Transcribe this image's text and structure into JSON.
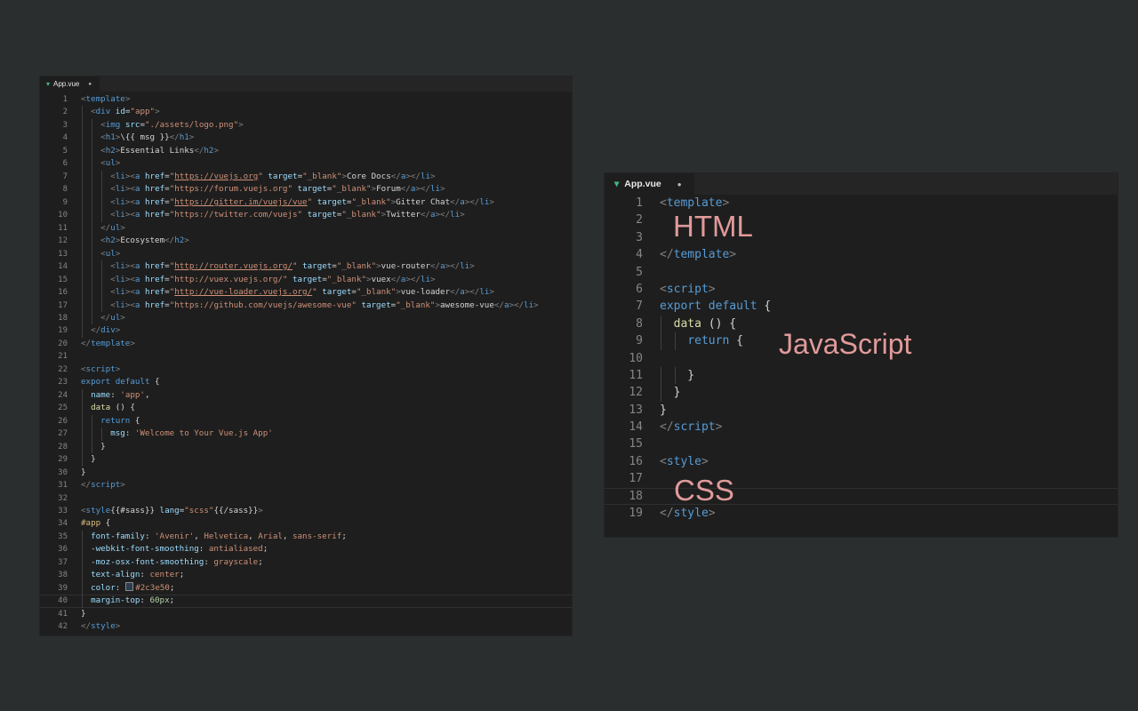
{
  "left_editor": {
    "tab": {
      "icon": "vue-file-icon",
      "filename": "App.vue",
      "modified_indicator": "●"
    },
    "lines": [
      [
        [
          "p",
          "<"
        ],
        [
          "t",
          "template"
        ],
        [
          "p",
          ">"
        ]
      ],
      [
        [
          "w",
          "  "
        ],
        [
          "p",
          "<"
        ],
        [
          "t",
          "div"
        ],
        [
          "w",
          " "
        ],
        [
          "a",
          "id"
        ],
        [
          "w",
          "="
        ],
        [
          "s",
          "\"app\""
        ],
        [
          "p",
          ">"
        ]
      ],
      [
        [
          "w",
          "    "
        ],
        [
          "p",
          "<"
        ],
        [
          "t",
          "img"
        ],
        [
          "w",
          " "
        ],
        [
          "a",
          "src"
        ],
        [
          "w",
          "="
        ],
        [
          "s",
          "\"./assets/logo.png\""
        ],
        [
          "p",
          ">"
        ]
      ],
      [
        [
          "w",
          "    "
        ],
        [
          "p",
          "<"
        ],
        [
          "t",
          "h1"
        ],
        [
          "p",
          ">"
        ],
        [
          "w",
          "\\{{ msg }}"
        ],
        [
          "p",
          "</"
        ],
        [
          "t",
          "h1"
        ],
        [
          "p",
          ">"
        ]
      ],
      [
        [
          "w",
          "    "
        ],
        [
          "p",
          "<"
        ],
        [
          "t",
          "h2"
        ],
        [
          "p",
          ">"
        ],
        [
          "w",
          "Essential Links"
        ],
        [
          "p",
          "</"
        ],
        [
          "t",
          "h2"
        ],
        [
          "p",
          ">"
        ]
      ],
      [
        [
          "w",
          "    "
        ],
        [
          "p",
          "<"
        ],
        [
          "t",
          "ul"
        ],
        [
          "p",
          ">"
        ]
      ],
      [
        [
          "w",
          "      "
        ],
        [
          "p",
          "<"
        ],
        [
          "t",
          "li"
        ],
        [
          "p",
          "><"
        ],
        [
          "t",
          "a"
        ],
        [
          "w",
          " "
        ],
        [
          "a",
          "href"
        ],
        [
          "w",
          "="
        ],
        [
          "s",
          "\""
        ],
        [
          "u",
          "https://vuejs.org"
        ],
        [
          "s",
          "\""
        ],
        [
          "w",
          " "
        ],
        [
          "a",
          "target"
        ],
        [
          "w",
          "="
        ],
        [
          "s",
          "\"_blank\""
        ],
        [
          "p",
          ">"
        ],
        [
          "w",
          "Core Docs"
        ],
        [
          "p",
          "</"
        ],
        [
          "t",
          "a"
        ],
        [
          "p",
          "></"
        ],
        [
          "t",
          "li"
        ],
        [
          "p",
          ">"
        ]
      ],
      [
        [
          "w",
          "      "
        ],
        [
          "p",
          "<"
        ],
        [
          "t",
          "li"
        ],
        [
          "p",
          "><"
        ],
        [
          "t",
          "a"
        ],
        [
          "w",
          " "
        ],
        [
          "a",
          "href"
        ],
        [
          "w",
          "="
        ],
        [
          "s",
          "\"https://forum.vuejs.org\""
        ],
        [
          "w",
          " "
        ],
        [
          "a",
          "target"
        ],
        [
          "w",
          "="
        ],
        [
          "s",
          "\"_blank\""
        ],
        [
          "p",
          ">"
        ],
        [
          "w",
          "Forum"
        ],
        [
          "p",
          "</"
        ],
        [
          "t",
          "a"
        ],
        [
          "p",
          "></"
        ],
        [
          "t",
          "li"
        ],
        [
          "p",
          ">"
        ]
      ],
      [
        [
          "w",
          "      "
        ],
        [
          "p",
          "<"
        ],
        [
          "t",
          "li"
        ],
        [
          "p",
          "><"
        ],
        [
          "t",
          "a"
        ],
        [
          "w",
          " "
        ],
        [
          "a",
          "href"
        ],
        [
          "w",
          "="
        ],
        [
          "s",
          "\""
        ],
        [
          "u",
          "https://gitter.im/vuejs/vue"
        ],
        [
          "s",
          "\""
        ],
        [
          "w",
          " "
        ],
        [
          "a",
          "target"
        ],
        [
          "w",
          "="
        ],
        [
          "s",
          "\"_blank\""
        ],
        [
          "p",
          ">"
        ],
        [
          "w",
          "Gitter Chat"
        ],
        [
          "p",
          "</"
        ],
        [
          "t",
          "a"
        ],
        [
          "p",
          "></"
        ],
        [
          "t",
          "li"
        ],
        [
          "p",
          ">"
        ]
      ],
      [
        [
          "w",
          "      "
        ],
        [
          "p",
          "<"
        ],
        [
          "t",
          "li"
        ],
        [
          "p",
          "><"
        ],
        [
          "t",
          "a"
        ],
        [
          "w",
          " "
        ],
        [
          "a",
          "href"
        ],
        [
          "w",
          "="
        ],
        [
          "s",
          "\"https://twitter.com/vuejs\""
        ],
        [
          "w",
          " "
        ],
        [
          "a",
          "target"
        ],
        [
          "w",
          "="
        ],
        [
          "s",
          "\"_blank\""
        ],
        [
          "p",
          ">"
        ],
        [
          "w",
          "Twitter"
        ],
        [
          "p",
          "</"
        ],
        [
          "t",
          "a"
        ],
        [
          "p",
          "></"
        ],
        [
          "t",
          "li"
        ],
        [
          "p",
          ">"
        ]
      ],
      [
        [
          "w",
          "    "
        ],
        [
          "p",
          "</"
        ],
        [
          "t",
          "ul"
        ],
        [
          "p",
          ">"
        ]
      ],
      [
        [
          "w",
          "    "
        ],
        [
          "p",
          "<"
        ],
        [
          "t",
          "h2"
        ],
        [
          "p",
          ">"
        ],
        [
          "w",
          "Ecosystem"
        ],
        [
          "p",
          "</"
        ],
        [
          "t",
          "h2"
        ],
        [
          "p",
          ">"
        ]
      ],
      [
        [
          "w",
          "    "
        ],
        [
          "p",
          "<"
        ],
        [
          "t",
          "ul"
        ],
        [
          "p",
          ">"
        ]
      ],
      [
        [
          "w",
          "      "
        ],
        [
          "p",
          "<"
        ],
        [
          "t",
          "li"
        ],
        [
          "p",
          "><"
        ],
        [
          "t",
          "a"
        ],
        [
          "w",
          " "
        ],
        [
          "a",
          "href"
        ],
        [
          "w",
          "="
        ],
        [
          "s",
          "\""
        ],
        [
          "u",
          "http://router.vuejs.org/"
        ],
        [
          "s",
          "\""
        ],
        [
          "w",
          " "
        ],
        [
          "a",
          "target"
        ],
        [
          "w",
          "="
        ],
        [
          "s",
          "\"_blank\""
        ],
        [
          "p",
          ">"
        ],
        [
          "w",
          "vue-router"
        ],
        [
          "p",
          "</"
        ],
        [
          "t",
          "a"
        ],
        [
          "p",
          "></"
        ],
        [
          "t",
          "li"
        ],
        [
          "p",
          ">"
        ]
      ],
      [
        [
          "w",
          "      "
        ],
        [
          "p",
          "<"
        ],
        [
          "t",
          "li"
        ],
        [
          "p",
          "><"
        ],
        [
          "t",
          "a"
        ],
        [
          "w",
          " "
        ],
        [
          "a",
          "href"
        ],
        [
          "w",
          "="
        ],
        [
          "s",
          "\"http://vuex.vuejs.org/\""
        ],
        [
          "w",
          " "
        ],
        [
          "a",
          "target"
        ],
        [
          "w",
          "="
        ],
        [
          "s",
          "\"_blank\""
        ],
        [
          "p",
          ">"
        ],
        [
          "w",
          "vuex"
        ],
        [
          "p",
          "</"
        ],
        [
          "t",
          "a"
        ],
        [
          "p",
          "></"
        ],
        [
          "t",
          "li"
        ],
        [
          "p",
          ">"
        ]
      ],
      [
        [
          "w",
          "      "
        ],
        [
          "p",
          "<"
        ],
        [
          "t",
          "li"
        ],
        [
          "p",
          "><"
        ],
        [
          "t",
          "a"
        ],
        [
          "w",
          " "
        ],
        [
          "a",
          "href"
        ],
        [
          "w",
          "="
        ],
        [
          "s",
          "\""
        ],
        [
          "u",
          "http://vue-loader.vuejs.org/"
        ],
        [
          "s",
          "\""
        ],
        [
          "w",
          " "
        ],
        [
          "a",
          "target"
        ],
        [
          "w",
          "="
        ],
        [
          "s",
          "\"_blank\""
        ],
        [
          "p",
          ">"
        ],
        [
          "w",
          "vue-loader"
        ],
        [
          "p",
          "</"
        ],
        [
          "t",
          "a"
        ],
        [
          "p",
          "></"
        ],
        [
          "t",
          "li"
        ],
        [
          "p",
          ">"
        ]
      ],
      [
        [
          "w",
          "      "
        ],
        [
          "p",
          "<"
        ],
        [
          "t",
          "li"
        ],
        [
          "p",
          "><"
        ],
        [
          "t",
          "a"
        ],
        [
          "w",
          " "
        ],
        [
          "a",
          "href"
        ],
        [
          "w",
          "="
        ],
        [
          "s",
          "\"https://github.com/vuejs/awesome-vue\""
        ],
        [
          "w",
          " "
        ],
        [
          "a",
          "target"
        ],
        [
          "w",
          "="
        ],
        [
          "s",
          "\"_blank\""
        ],
        [
          "p",
          ">"
        ],
        [
          "w",
          "awesome-vue"
        ],
        [
          "p",
          "</"
        ],
        [
          "t",
          "a"
        ],
        [
          "p",
          "></"
        ],
        [
          "t",
          "li"
        ],
        [
          "p",
          ">"
        ]
      ],
      [
        [
          "w",
          "    "
        ],
        [
          "p",
          "</"
        ],
        [
          "t",
          "ul"
        ],
        [
          "p",
          ">"
        ]
      ],
      [
        [
          "w",
          "  "
        ],
        [
          "p",
          "</"
        ],
        [
          "t",
          "div"
        ],
        [
          "p",
          ">"
        ]
      ],
      [
        [
          "p",
          "</"
        ],
        [
          "t",
          "template"
        ],
        [
          "p",
          ">"
        ]
      ],
      [],
      [
        [
          "p",
          "<"
        ],
        [
          "t",
          "script"
        ],
        [
          "p",
          ">"
        ]
      ],
      [
        [
          "k",
          "export"
        ],
        [
          "w",
          " "
        ],
        [
          "k",
          "default"
        ],
        [
          "w",
          " {"
        ]
      ],
      [
        [
          "w",
          "  "
        ],
        [
          "a",
          "name"
        ],
        [
          "w",
          ": "
        ],
        [
          "s",
          "'app'"
        ],
        [
          "w",
          ","
        ]
      ],
      [
        [
          "w",
          "  "
        ],
        [
          "f",
          "data"
        ],
        [
          "w",
          " () {"
        ]
      ],
      [
        [
          "w",
          "    "
        ],
        [
          "k",
          "return"
        ],
        [
          "w",
          " {"
        ]
      ],
      [
        [
          "w",
          "      "
        ],
        [
          "a",
          "msg"
        ],
        [
          "w",
          ": "
        ],
        [
          "s",
          "'Welcome to Your Vue.js App'"
        ]
      ],
      [
        [
          "w",
          "    }"
        ]
      ],
      [
        [
          "w",
          "  }"
        ]
      ],
      [
        [
          "w",
          "}"
        ]
      ],
      [
        [
          "p",
          "</"
        ],
        [
          "t",
          "script"
        ],
        [
          "p",
          ">"
        ]
      ],
      [],
      [
        [
          "p",
          "<"
        ],
        [
          "t",
          "style"
        ],
        [
          "w",
          "{{#sass}} "
        ],
        [
          "a",
          "lang"
        ],
        [
          "w",
          "="
        ],
        [
          "s",
          "\"scss\""
        ],
        [
          "w",
          "{{/sass}}"
        ],
        [
          "p",
          ">"
        ]
      ],
      [
        [
          "c",
          "#app"
        ],
        [
          "w",
          " {"
        ]
      ],
      [
        [
          "w",
          "  "
        ],
        [
          "a",
          "font-family"
        ],
        [
          "w",
          ": "
        ],
        [
          "s",
          "'Avenir'"
        ],
        [
          "w",
          ", "
        ],
        [
          "s",
          "Helvetica"
        ],
        [
          "w",
          ", "
        ],
        [
          "s",
          "Arial"
        ],
        [
          "w",
          ", "
        ],
        [
          "s",
          "sans-serif"
        ],
        [
          "w",
          ";"
        ]
      ],
      [
        [
          "w",
          "  "
        ],
        [
          "a",
          "-webkit-font-smoothing"
        ],
        [
          "w",
          ": "
        ],
        [
          "s",
          "antialiased"
        ],
        [
          "w",
          ";"
        ]
      ],
      [
        [
          "w",
          "  "
        ],
        [
          "a",
          "-moz-osx-font-smoothing"
        ],
        [
          "w",
          ": "
        ],
        [
          "s",
          "grayscale"
        ],
        [
          "w",
          ";"
        ]
      ],
      [
        [
          "w",
          "  "
        ],
        [
          "a",
          "text-align"
        ],
        [
          "w",
          ": "
        ],
        [
          "s",
          "center"
        ],
        [
          "w",
          ";"
        ]
      ],
      [
        [
          "w",
          "  "
        ],
        [
          "a",
          "color"
        ],
        [
          "w",
          ": "
        ],
        [
          "sw",
          "#2c3e50"
        ],
        [
          "s",
          "#2c3e50"
        ],
        [
          "w",
          ";"
        ]
      ],
      [
        [
          "w",
          "  "
        ],
        [
          "a",
          "margin-top"
        ],
        [
          "w",
          ": "
        ],
        [
          "n",
          "60px"
        ],
        [
          "w",
          ";"
        ]
      ],
      [
        [
          "w",
          "}"
        ]
      ],
      [
        [
          "p",
          "</"
        ],
        [
          "t",
          "style"
        ],
        [
          "p",
          ">"
        ]
      ]
    ],
    "current_line": 40
  },
  "right_editor": {
    "tab": {
      "icon": "vue-file-icon",
      "filename": "App.vue",
      "modified_indicator": "●"
    },
    "lines": [
      [
        [
          "p",
          "<"
        ],
        [
          "t",
          "template"
        ],
        [
          "p",
          ">"
        ]
      ],
      [],
      [],
      [
        [
          "p",
          "</"
        ],
        [
          "t",
          "template"
        ],
        [
          "p",
          ">"
        ]
      ],
      [],
      [
        [
          "p",
          "<"
        ],
        [
          "t",
          "script"
        ],
        [
          "p",
          ">"
        ]
      ],
      [
        [
          "k",
          "export"
        ],
        [
          "w",
          " "
        ],
        [
          "k",
          "default"
        ],
        [
          "w",
          " {"
        ]
      ],
      [
        [
          "w",
          "  "
        ],
        [
          "f",
          "data"
        ],
        [
          "w",
          " () {"
        ]
      ],
      [
        [
          "w",
          "    "
        ],
        [
          "k",
          "return"
        ],
        [
          "w",
          " {"
        ]
      ],
      [],
      [
        [
          "w",
          "    }"
        ]
      ],
      [
        [
          "w",
          "  }"
        ]
      ],
      [
        [
          "w",
          "}"
        ]
      ],
      [
        [
          "p",
          "</"
        ],
        [
          "t",
          "script"
        ],
        [
          "p",
          ">"
        ]
      ],
      [],
      [
        [
          "p",
          "<"
        ],
        [
          "t",
          "style"
        ],
        [
          "p",
          ">"
        ]
      ],
      [],
      [],
      [
        [
          "p",
          "</"
        ],
        [
          "t",
          "style"
        ],
        [
          "p",
          ">"
        ]
      ]
    ],
    "current_line": 18,
    "annotations": {
      "html": "HTML",
      "javascript": "JavaScript",
      "css": "CSS"
    },
    "annotation_color": "#e19a9a"
  }
}
